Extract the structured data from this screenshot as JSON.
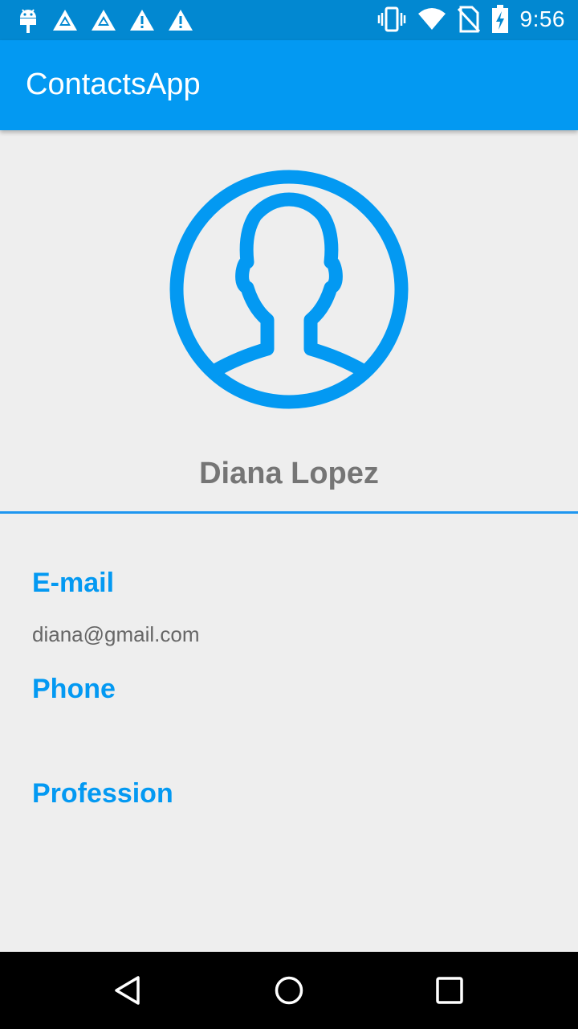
{
  "status_bar": {
    "time": "9:56",
    "left_icons": [
      "android-debug-icon",
      "triangle-notification-icon",
      "triangle-notification-icon",
      "warning-icon",
      "warning-icon"
    ],
    "right_icons": [
      "vibrate-icon",
      "wifi-icon",
      "no-sim-icon",
      "battery-charging-icon"
    ],
    "color": "#0288D1"
  },
  "app_bar": {
    "title": "ContactsApp",
    "color": "#0399F2"
  },
  "contact": {
    "avatar_icon": "person-circle-icon",
    "name": "Diana Lopez",
    "fields": {
      "email": {
        "label": "E-mail",
        "value": "diana@gmail.com"
      },
      "phone": {
        "label": "Phone",
        "value": ""
      },
      "profession": {
        "label": "Profession",
        "value": ""
      }
    }
  },
  "colors": {
    "accent": "#0399F2",
    "background": "#EEEEEE",
    "name_text": "#757575",
    "value_text": "#666666"
  },
  "nav_bar": {
    "buttons": [
      "back-icon",
      "home-icon",
      "recents-icon"
    ]
  }
}
